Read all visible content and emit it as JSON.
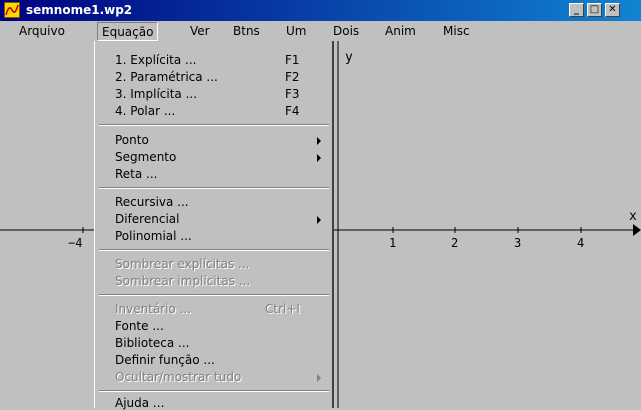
{
  "window": {
    "title": "semnome1.wp2",
    "minimize": "_",
    "maximize": "□",
    "close": "✕"
  },
  "menubar": [
    "Arquivo",
    "Equação",
    "Ver",
    "Btns",
    "Um",
    "Dois",
    "Anim",
    "Misc"
  ],
  "dropdown": {
    "items": [
      {
        "label": "1. Explícita ...",
        "shortcut": "F1"
      },
      {
        "label": "2. Paramétrica ...",
        "shortcut": "F2"
      },
      {
        "label": "3. Implícita ...",
        "shortcut": "F3"
      },
      {
        "label": "4. Polar ...",
        "shortcut": "F4"
      },
      {
        "label": "Ponto"
      },
      {
        "label": "Segmento"
      },
      {
        "label": "Reta ..."
      },
      {
        "label": "Recursiva ..."
      },
      {
        "label": "Diferencial"
      },
      {
        "label": "Polinomial ..."
      },
      {
        "label": "Sombrear explícitas ..."
      },
      {
        "label": "Sombrear implícitas ..."
      },
      {
        "label": "Inventário ...",
        "shortcut": "Ctrl+I"
      },
      {
        "label": "Fonte ..."
      },
      {
        "label": "Biblioteca ..."
      },
      {
        "label": "Definir função ..."
      },
      {
        "label": "Ocultar/mostrar tudo"
      },
      {
        "label": "Ajuda ..."
      }
    ]
  },
  "plot": {
    "x_axis_label": "x",
    "y_axis_label": "y",
    "ticks": [
      "−4",
      "1",
      "2",
      "3",
      "4"
    ]
  }
}
